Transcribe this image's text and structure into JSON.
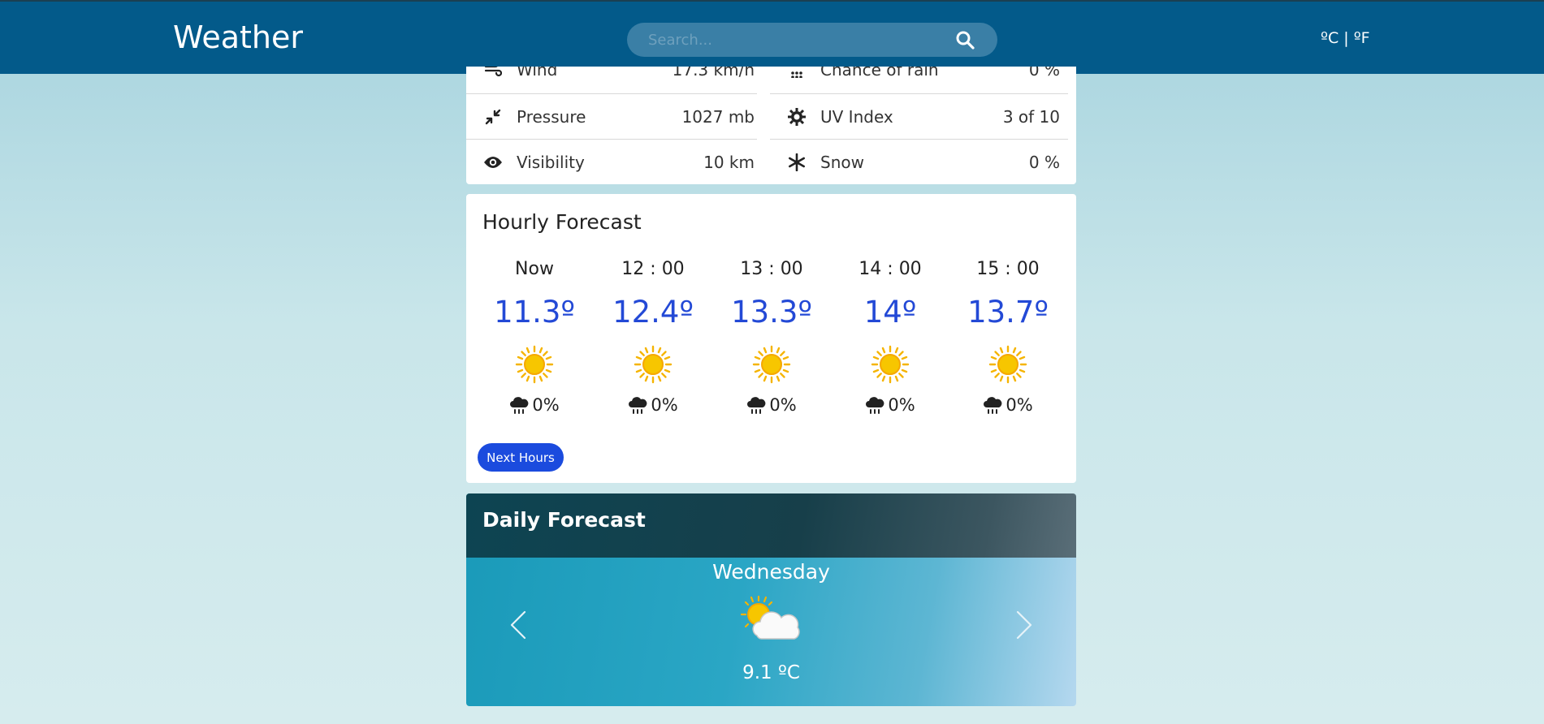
{
  "app": {
    "title": "Weather"
  },
  "search": {
    "placeholder": "Search..."
  },
  "units": {
    "label": "ºC | ºF"
  },
  "details": {
    "rows": [
      {
        "label": "Wind",
        "value": "17.3 km/h",
        "icon": "wind-icon"
      },
      {
        "label": "Chance of rain",
        "value": "0 %",
        "icon": "rain-chance-icon"
      },
      {
        "label": "Pressure",
        "value": "1027 mb",
        "icon": "compress-icon"
      },
      {
        "label": "UV Index",
        "value": "3 of 10",
        "icon": "sun-gear-icon"
      },
      {
        "label": "Visibility",
        "value": "10 km",
        "icon": "eye-icon"
      },
      {
        "label": "Snow",
        "value": "0 %",
        "icon": "snowflake-icon"
      }
    ]
  },
  "hourly": {
    "title": "Hourly Forecast",
    "items": [
      {
        "time": "Now",
        "temp": "11.3º",
        "rain": "0%"
      },
      {
        "time": "12 : 00",
        "temp": "12.4º",
        "rain": "0%"
      },
      {
        "time": "13 : 00",
        "temp": "13.3º",
        "rain": "0%"
      },
      {
        "time": "14 : 00",
        "temp": "14º",
        "rain": "0%"
      },
      {
        "time": "15 : 00",
        "temp": "13.7º",
        "rain": "0%"
      }
    ],
    "next_label": "Next Hours"
  },
  "daily": {
    "title": "Daily Forecast",
    "day": "Wednesday",
    "temp": "9.1 ºC",
    "icon": "partly-cloudy-icon"
  },
  "colors": {
    "navbar": "#035a8a",
    "temp_blue": "#2349d6",
    "button_blue": "#1b4bde"
  }
}
